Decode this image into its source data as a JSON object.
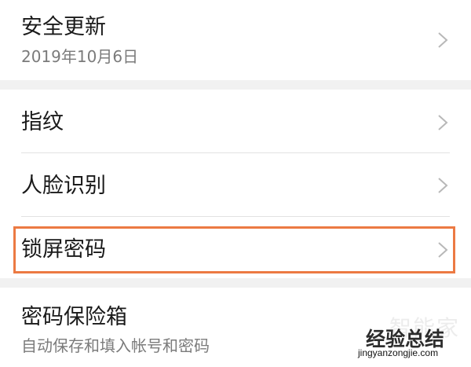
{
  "settings": {
    "security_update": {
      "title": "安全更新",
      "subtitle": "2019年10月6日"
    },
    "fingerprint": {
      "title": "指纹"
    },
    "face_recognition": {
      "title": "人脸识别"
    },
    "lock_screen_password": {
      "title": "锁屏密码"
    },
    "password_vault": {
      "title": "密码保险箱",
      "subtitle": "自动保存和填入帐号和密码"
    }
  },
  "watermark": {
    "faint_text": "智能家",
    "strong_text": "经验总结",
    "url": "jingyanzongjie.com"
  },
  "colors": {
    "highlight": "#ec7a43",
    "background": "#f1f1f1",
    "card": "#ffffff"
  },
  "icons": {
    "row_arrow": "chevron-right-icon"
  }
}
